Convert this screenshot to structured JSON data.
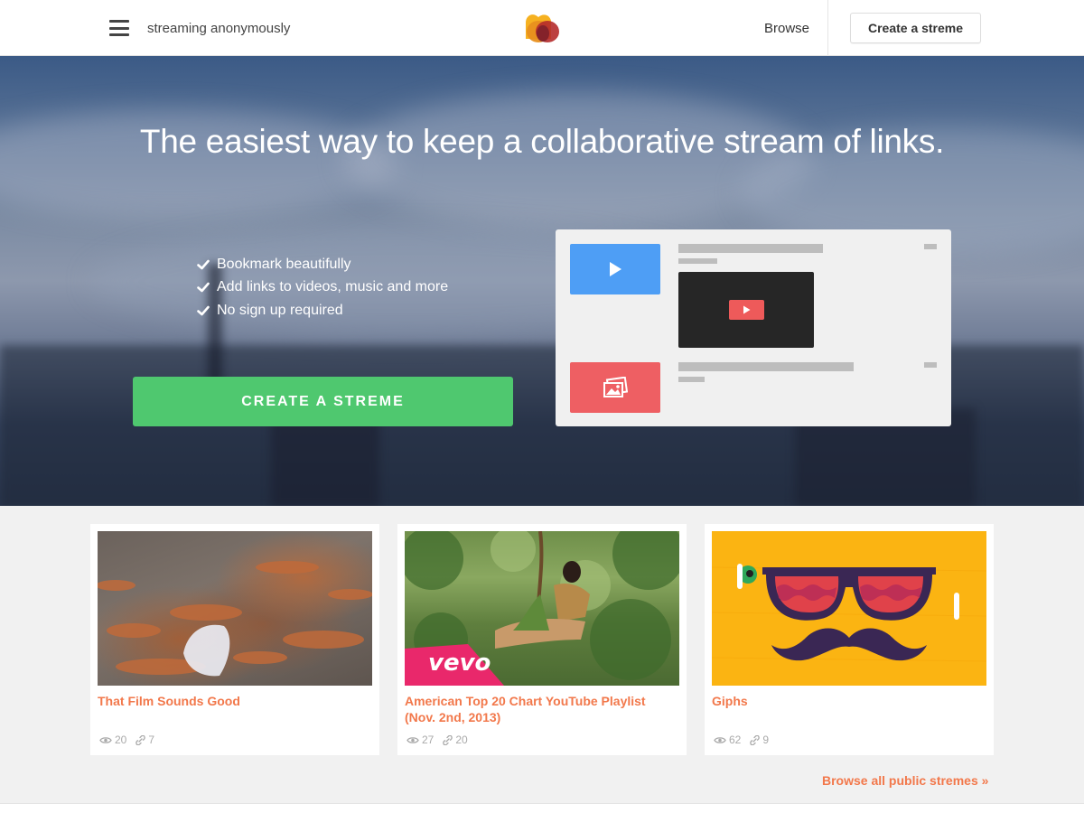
{
  "header": {
    "status_text": "streaming anonymously",
    "browse_label": "Browse",
    "create_label": "Create a streme"
  },
  "hero": {
    "title": "The easiest way to keep a collaborative stream of links.",
    "features": [
      "Bookmark beautifully",
      "Add links to videos, music and more",
      "No sign up required"
    ],
    "cta_label": "CREATE A STREME"
  },
  "cards": [
    {
      "title": "That Film Sounds Good",
      "views": "20",
      "links": "7"
    },
    {
      "title": "American Top 20 Chart YouTube Playlist (Nov. 2nd, 2013)",
      "views": "27",
      "links": "20",
      "thumb_badge": "vevo"
    },
    {
      "title": "Giphs",
      "views": "62",
      "links": "9"
    }
  ],
  "browse_all_label": "Browse all public stremes »",
  "colors": {
    "accent_orange": "#f2784b",
    "cta_green": "#4fc86f",
    "tile_blue": "#4e9ef5",
    "tile_red": "#ee5f63"
  },
  "icons": [
    "menu-icon",
    "logo-icon",
    "check-icon",
    "play-icon",
    "image-icon",
    "eye-icon",
    "link-icon"
  ]
}
